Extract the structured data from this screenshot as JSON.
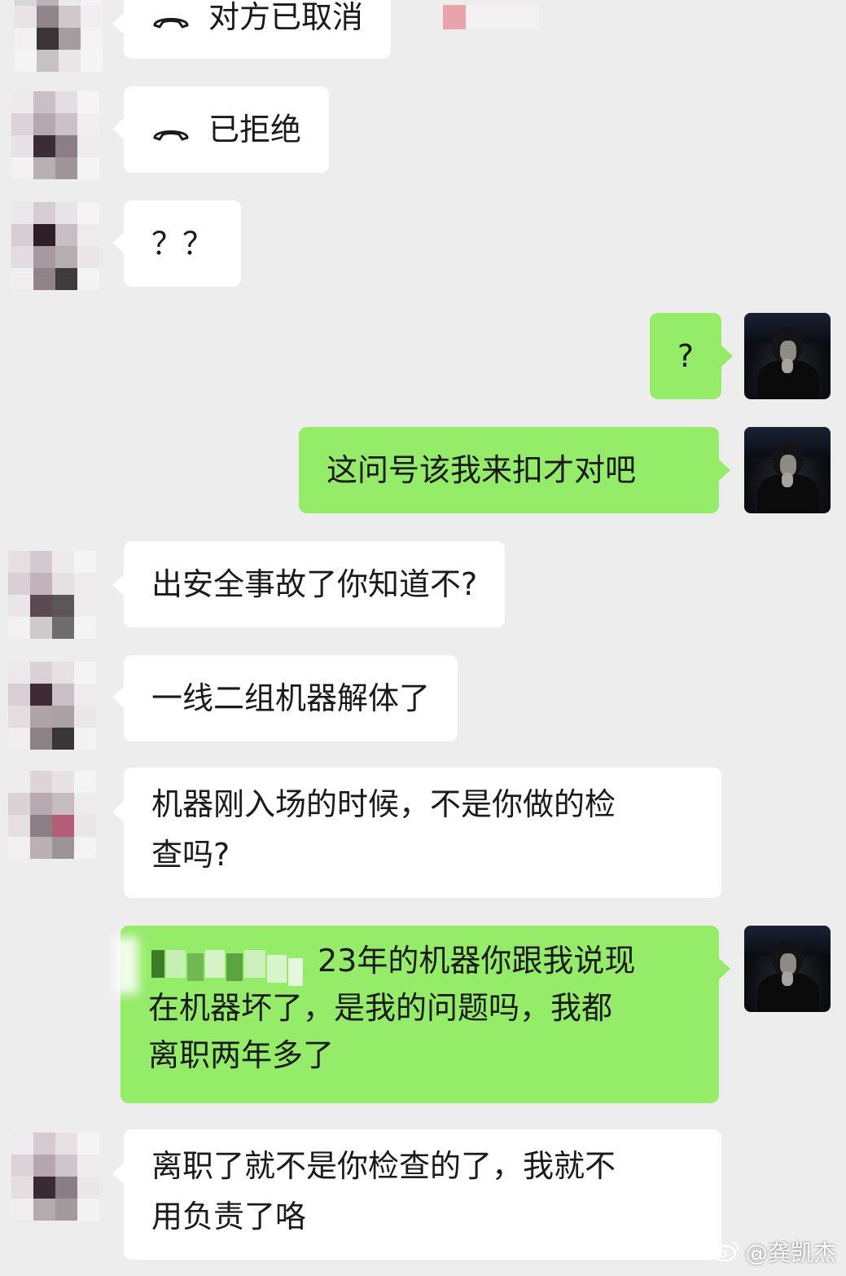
{
  "colors": {
    "background": "#ededed",
    "received_bubble": "#ffffff",
    "sent_bubble": "#95ec69"
  },
  "messages": [
    {
      "side": "left",
      "type": "call",
      "icon": "phone-hangup-icon",
      "text": "对方已取消"
    },
    {
      "side": "left",
      "type": "call",
      "icon": "phone-hangup-icon",
      "text": "已拒绝"
    },
    {
      "side": "left",
      "type": "text",
      "text": "？？"
    },
    {
      "side": "right",
      "type": "text",
      "text": "?"
    },
    {
      "side": "right",
      "type": "text",
      "text": "这问号该我来扣才对吧"
    },
    {
      "side": "left",
      "type": "text",
      "text": "出安全事故了你知道不?"
    },
    {
      "side": "left",
      "type": "text",
      "text": "一线二组机器解体了"
    },
    {
      "side": "left",
      "type": "text",
      "lines": [
        "机器刚入场的时候，不是你做的检",
        "查吗?"
      ]
    },
    {
      "side": "right",
      "type": "text",
      "lines": [
        "23年的机器你跟我说现",
        "在机器坏了，是我的问题吗，我都",
        "离职两年多了"
      ]
    },
    {
      "side": "left",
      "type": "text",
      "lines": [
        "离职了就不是你检查的了，我就不",
        "用负责了咯"
      ]
    }
  ],
  "watermark": {
    "icon": "weibo-icon",
    "text": "@龚凯杰"
  }
}
